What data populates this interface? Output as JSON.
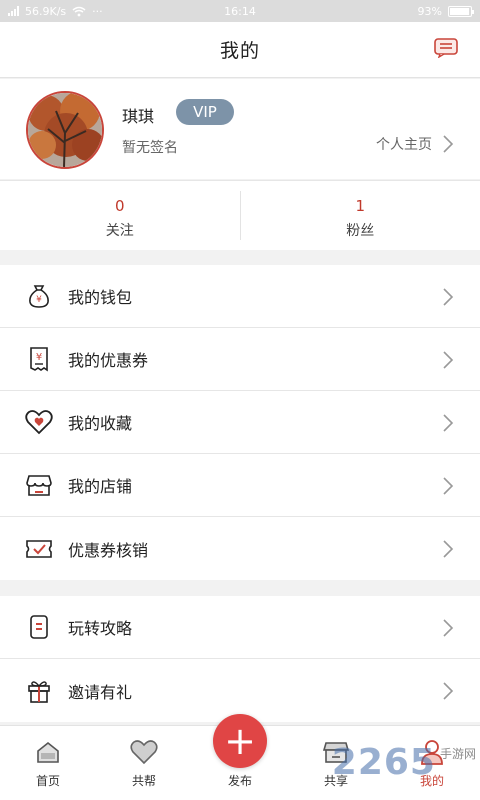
{
  "statusbar": {
    "speed": "56.9K/s",
    "more": "···",
    "time": "16:14",
    "battery": "93%",
    "battery_level": 0.93
  },
  "header": {
    "title": "我的",
    "message_icon": "message-icon"
  },
  "profile": {
    "username": "琪琪",
    "vip": "VIP",
    "signature": "暂无签名",
    "homepage": "个人主页"
  },
  "stats": [
    {
      "value": "0",
      "label": "关注"
    },
    {
      "value": "1",
      "label": "粉丝"
    }
  ],
  "menu_group_1": [
    {
      "label": "我的钱包",
      "icon": "wallet-icon"
    },
    {
      "label": "我的优惠券",
      "icon": "coupon-icon"
    },
    {
      "label": "我的收藏",
      "icon": "heart-icon"
    },
    {
      "label": "我的店铺",
      "icon": "store-icon"
    },
    {
      "label": "优惠券核销",
      "icon": "ticket-check-icon"
    }
  ],
  "menu_group_2": [
    {
      "label": "玩转攻略",
      "icon": "guide-icon"
    },
    {
      "label": "邀请有礼",
      "icon": "gift-icon"
    }
  ],
  "tabbar": [
    {
      "label": "首页",
      "icon": "home-icon"
    },
    {
      "label": "共帮",
      "icon": "heart-tab-icon"
    },
    {
      "label": "发布",
      "icon": "plus-icon"
    },
    {
      "label": "共享",
      "icon": "share-icon"
    },
    {
      "label": "我的",
      "icon": "user-icon"
    }
  ],
  "publish_symbol": "+",
  "watermark": {
    "number": "2265",
    "text": "手游网"
  },
  "colors": {
    "accent": "#c9453a",
    "vip": "#7d93a8",
    "publish": "#e04545"
  }
}
